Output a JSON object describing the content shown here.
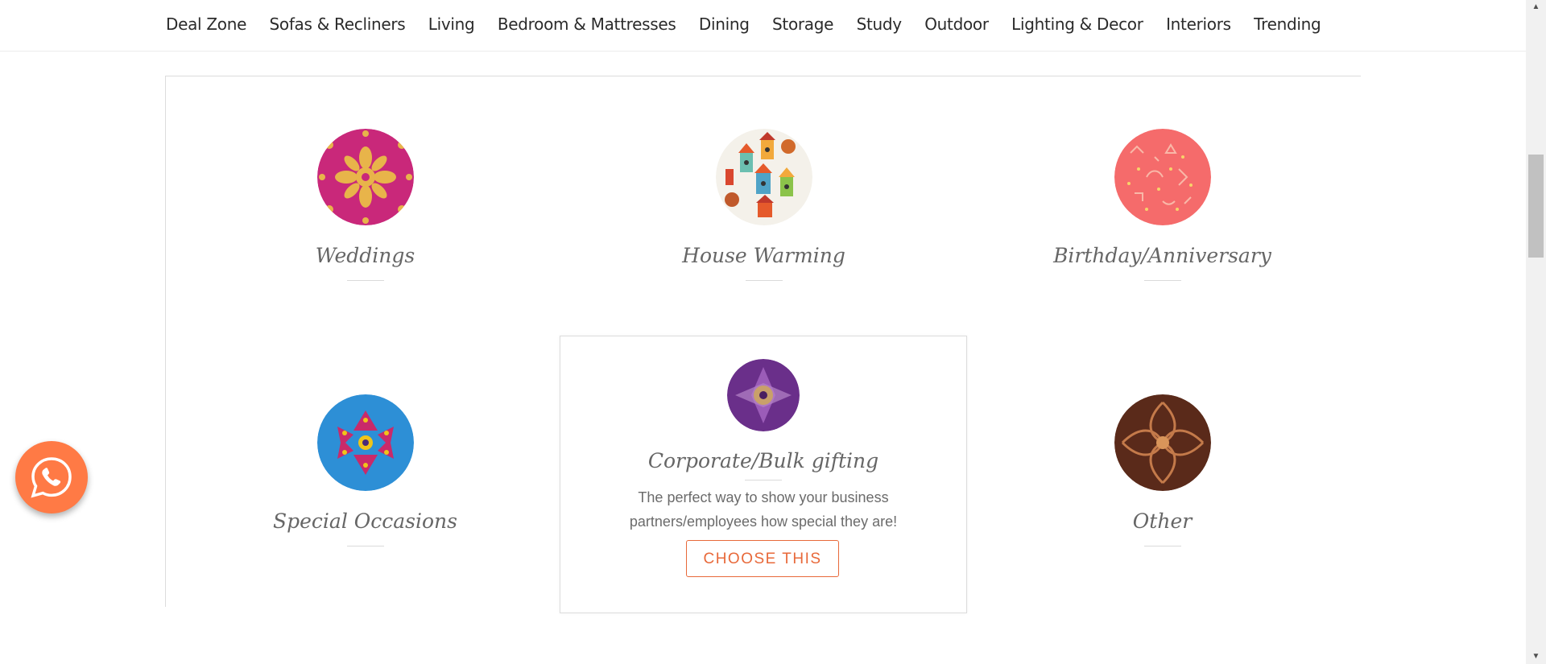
{
  "nav": {
    "items": [
      "Deal Zone",
      "Sofas & Recliners",
      "Living",
      "Bedroom & Mattresses",
      "Dining",
      "Storage",
      "Study",
      "Outdoor",
      "Lighting & Decor",
      "Interiors",
      "Trending"
    ]
  },
  "occasions": {
    "weddings": {
      "label": "Weddings",
      "icon": "mandala-pattern-icon"
    },
    "house_warming": {
      "label": "House Warming",
      "icon": "birdhouse-pattern-icon"
    },
    "birthday": {
      "label": "Birthday/Anniversary",
      "icon": "party-pattern-icon"
    },
    "special": {
      "label": "Special Occasions",
      "icon": "kaleidoscope-pattern-icon"
    },
    "corporate": {
      "label": "Corporate/Bulk gifting",
      "description": "The perfect way to show your business partners/employees how special they are!",
      "button": "CHOOSE THIS",
      "icon": "purple-kaleidoscope-icon"
    },
    "other": {
      "label": "Other",
      "icon": "brown-paisley-icon"
    }
  },
  "colors": {
    "accent": "#e8693a",
    "whatsapp_bg": "#ff7a45"
  },
  "widgets": {
    "whatsapp_icon": "whatsapp-icon"
  }
}
